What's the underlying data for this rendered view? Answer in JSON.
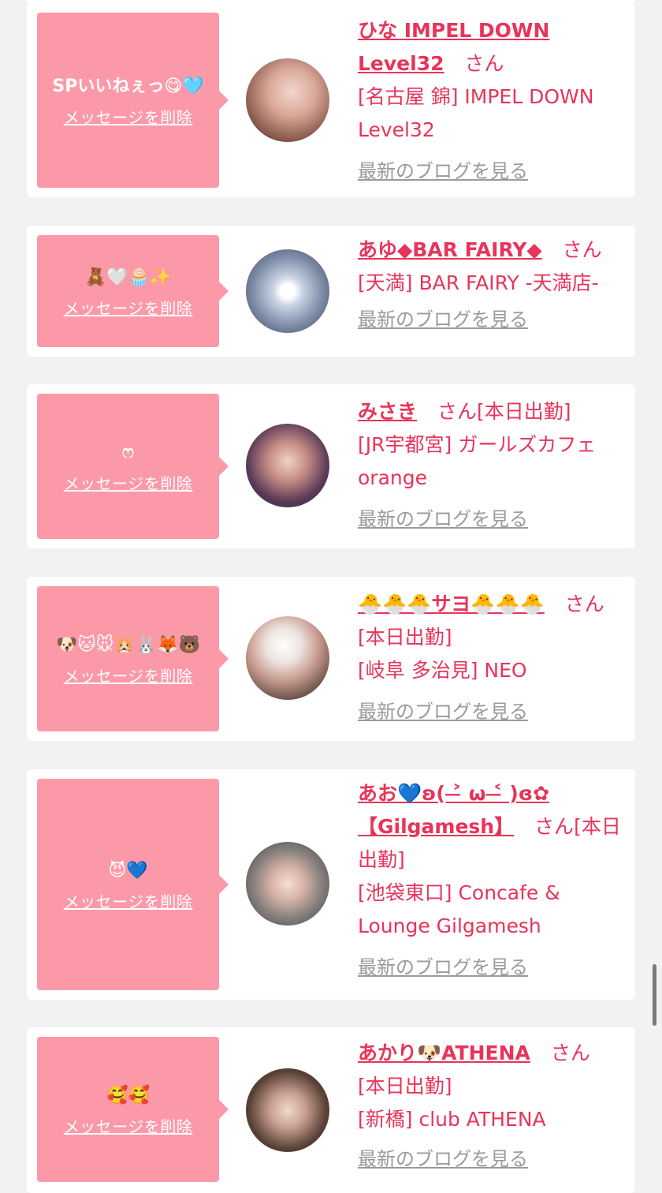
{
  "ui": {
    "accent": "#e8345a",
    "bubble_bg": "#fc99a8",
    "delete_label": "メッセージを削除",
    "san": "さん",
    "blog_link": "最新のブログを見る"
  },
  "items": [
    {
      "message": "SPいいねぇっ😋🩵",
      "name": "ひな IMPEL DOWN Level32",
      "status": "",
      "shop": "[名古屋 錦] IMPEL DOWN Level32",
      "avatar_icon": "avatar-photo"
    },
    {
      "message": "🧸🤍🧁✨",
      "name": "あゆ◆BAR FAIRY◆",
      "status": "",
      "shop": "[天満] BAR FAIRY -天満店-",
      "avatar_icon": "avatar-photo"
    },
    {
      "message": "ෆ‪",
      "name": "みさき",
      "status": "[本日出勤]",
      "shop": "[JR宇都宮] ガールズカフェorange",
      "avatar_icon": "avatar-photo"
    },
    {
      "message": "🐶🐱🐭🐹🐰🦊🐻",
      "name": "🐣🐣🐣サヨ🐣🐣🐣",
      "status": "[本日出勤]",
      "shop": "[岐阜 多治見] NEO",
      "avatar_icon": "avatar-photo"
    },
    {
      "message": "😈💙",
      "name": "あお💙ʚ( ˃̶ ω ˂̶ )ɞ✿ 【Gilgamesh】",
      "status": "[本日出勤]",
      "shop": "[池袋東口] Concafe & Lounge Gilgamesh",
      "avatar_icon": "avatar-photo"
    },
    {
      "message": "🥰🥰",
      "name": "あかり🐶ATHENA",
      "status": "[本日出勤]",
      "shop": "[新橋] club ATHENA",
      "avatar_icon": "avatar-photo"
    }
  ]
}
